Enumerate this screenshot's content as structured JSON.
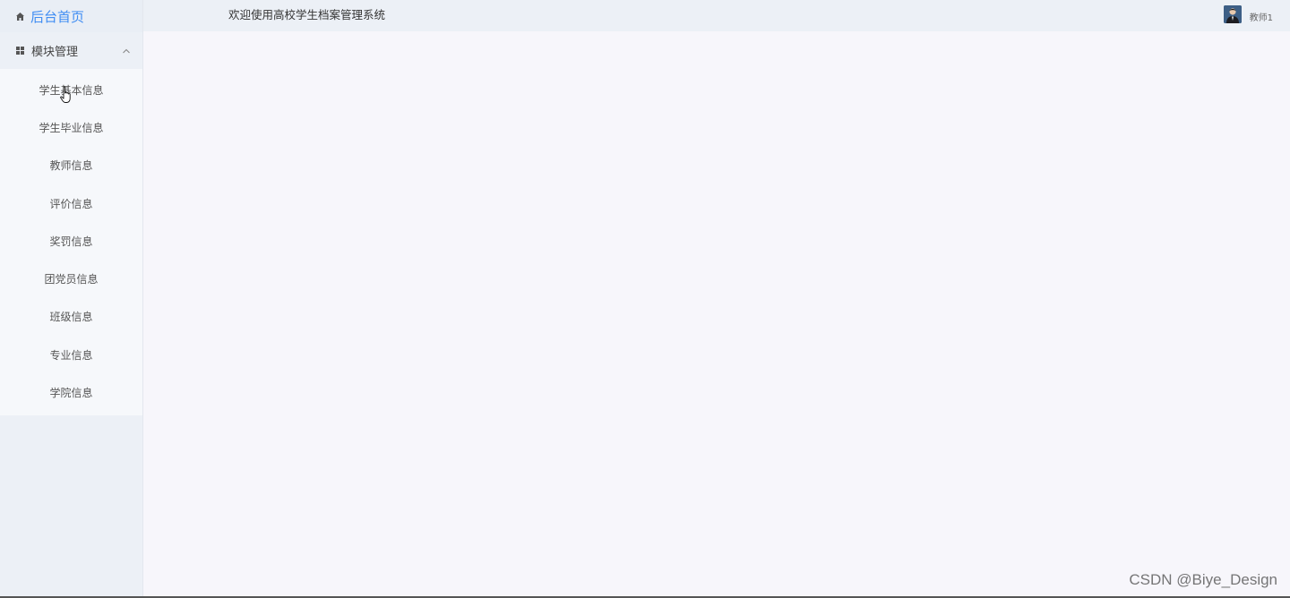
{
  "sidebar": {
    "home": {
      "label": "后台首页",
      "icon": "home-icon"
    },
    "module": {
      "label": "模块管理",
      "icon": "grid-icon",
      "expanded": true
    },
    "items": [
      {
        "label": "学生基本信息"
      },
      {
        "label": "学生毕业信息"
      },
      {
        "label": "教师信息"
      },
      {
        "label": "评价信息"
      },
      {
        "label": "奖罚信息"
      },
      {
        "label": "团党员信息"
      },
      {
        "label": "班级信息"
      },
      {
        "label": "专业信息"
      },
      {
        "label": "学院信息"
      }
    ]
  },
  "header": {
    "title": "欢迎使用高校学生档案管理系统",
    "user": {
      "name": "教师1",
      "avatar": "avatar"
    }
  },
  "watermark": "CSDN @Biye_Design",
  "colors": {
    "accent": "#3f8df3",
    "sidebar_bg": "#ecf0f6",
    "main_bg": "#f7f6fb"
  }
}
